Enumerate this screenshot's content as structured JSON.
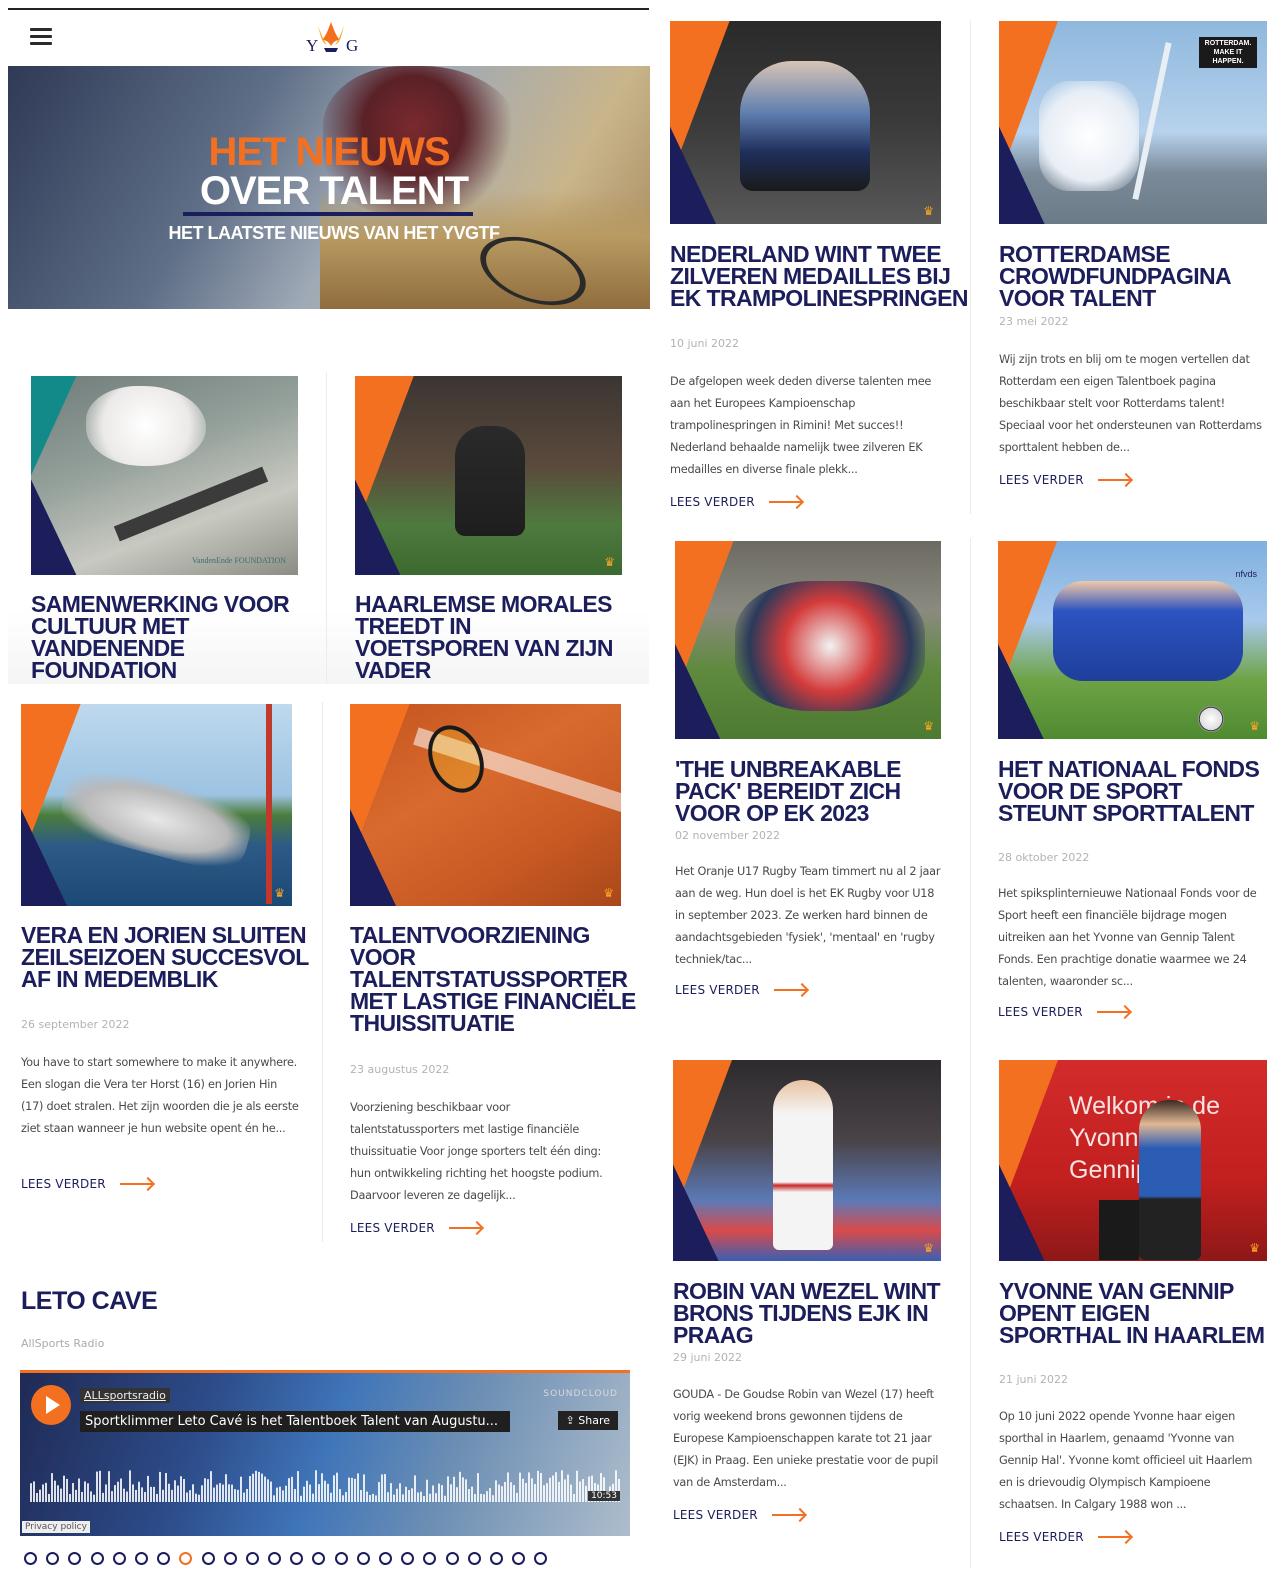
{
  "header": {
    "logo_text_left": "Y",
    "logo_text_right": "G",
    "menu_icon": "hamburger-icon"
  },
  "hero": {
    "line1": "HET NIEUWS",
    "line2": "OVER TALENT",
    "line3": "HET LAATSTE NIEUWS VAN HET YVGTF"
  },
  "read_more": "LEES VERDER",
  "left_cards": [
    {
      "title": "SAMENWERKING VOOR CULTUUR MET VANDENENDE FOUNDATION",
      "image": "skateboard-ballet-photo",
      "watermark": "VandenEnde FOUNDATION"
    },
    {
      "title": "HAARLEMSE MORALES TREEDT IN VOETSPOREN VAN ZIJN VADER",
      "image": "baseball-pitcher-photo"
    },
    {
      "title": "VERA EN JORIEN SLUITEN ZEILSEIZOEN SUCCESVOL AF IN MEDEMBLIK",
      "date": "26 september 2022",
      "excerpt": "You have to start somewhere to make it anywhere. Een slogan die Vera ter Horst (16) en Jorien Hin (17) doet stralen. Het zijn woorden die je als eerste ziet staan wanneer je hun website opent én he...",
      "image": "sailing-photo"
    },
    {
      "title": "TALENTVOORZIENING VOOR TALENTSTATUSSPORTER MET LASTIGE FINANCIËLE THUISSITUATIE",
      "date": "23 augustus 2022",
      "excerpt": "Voorziening beschikbaar voor talentstatussporters met lastige financiële thuissituatie Voor jonge sporters telt één ding: hun ontwikkeling richting het hoogste podium. Daarvoor leveren ze dagelijk...",
      "image": "tennis-photo"
    }
  ],
  "section": {
    "title": "LETO CAVE",
    "subtitle": "AllSports Radio"
  },
  "soundcloud": {
    "artist": "ALLsportsradio",
    "track": "Sportklimmer Leto Cavé is het Talentboek Talent van Augustu...",
    "brand": "SOUNDCLOUD",
    "share": "Share",
    "duration": "10:53",
    "privacy": "Privacy policy"
  },
  "pager": {
    "count": 24,
    "active": 7
  },
  "right_cards": [
    {
      "title": "NEDERLAND WINT TWEE ZILVEREN MEDAILLES BIJ EK TRAMPOLINESPRINGEN",
      "date": "10 juni 2022",
      "excerpt": "De afgelopen week deden diverse talenten mee aan het Europees Kampioenschap trampolinespringen in Rimini! Met succes!! Nederland behaalde namelijk twee zilveren EK medailles en diverse finale plekk...",
      "image": "trampoline-athletes-photo"
    },
    {
      "title": "ROTTERDAMSE CROWDFUNDPAGINA VOOR TALENT",
      "date": "23 mei 2022",
      "excerpt": "Wij zijn trots en blij om te mogen vertellen dat Rotterdam een eigen Talentboek pagina beschikbaar stelt voor Rotterdams talent! Speciaal voor het ondersteunen van Rotterdams sporttalent hebben de...",
      "image": "karate-rotterdam-photo",
      "badge": "ROTTERDAM. MAKE IT HAPPEN."
    },
    {
      "title": "'THE UNBREAKABLE PACK' BEREIDT ZICH VOOR OP EK 2023",
      "date": "02 november 2022",
      "excerpt": "Het Oranje U17 Rugby Team timmert nu al 2 jaar aan de weg. Hun doel is het EK Rugby voor U18 in september 2023. Ze werken hard binnen de aandachtsgebieden 'fysiek', 'mentaal' en 'rugby techniek/tac...",
      "image": "rugby-photo"
    },
    {
      "title": "HET NATIONAAL FONDS VOOR DE SPORT STEUNT SPORTTALENT",
      "date": "28 oktober 2022",
      "excerpt": "Het spiksplinternieuwe Nationaal Fonds voor de Sport heeft een financiële bijdrage mogen uitreiken aan het Yvonne van Gennip Talent Fonds. Een prachtige donatie waarmee we 24 talenten, waaronder sc...",
      "image": "kids-football-photo",
      "badge": "nfvds"
    },
    {
      "title": "ROBIN VAN WEZEL WINT BRONS TIJDENS EJK IN PRAAG",
      "date": "29 juni 2022",
      "excerpt": "GOUDA - De Goudse Robin van Wezel (17) heeft vorig weekend brons gewonnen tijdens de Europese Kampioenschappen karate tot 21 jaar (EJK) in Praag. Een unieke prestatie voor de pupil van de Amsterdam...",
      "image": "karate-robin-photo"
    },
    {
      "title": "YVONNE VAN GENNIP OPENT EIGEN SPORTHAL IN HAARLEM",
      "date": "21 juni 2022",
      "excerpt": "Op 10 juni 2022 opende Yvonne haar eigen sporthal in Haarlem, genaamd 'Yvonne van Gennip Hal'. Yvonne komt officieel uit Haarlem en is drievoudig Olympisch Kampioene schaatsen. In Calgary 1988 won ...",
      "image": "sporthal-opening-photo",
      "banner": "Welkom in de Yvonne van Gennip"
    }
  ],
  "colors": {
    "navy": "#1c1d5b",
    "orange": "#f37021",
    "gold": "#f5a623"
  }
}
